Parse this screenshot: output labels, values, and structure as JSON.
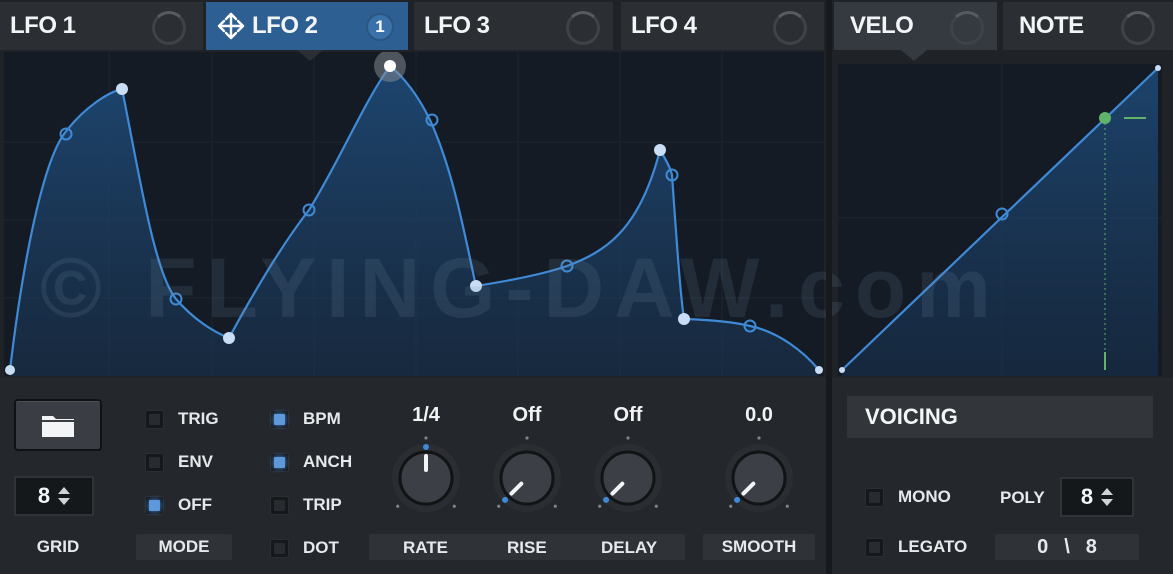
{
  "tabs": {
    "lfo1": "LFO 1",
    "lfo2": "LFO 2",
    "lfo2_badge": "1",
    "lfo3": "LFO 3",
    "lfo4": "LFO 4",
    "velo": "VELO",
    "note": "NOTE"
  },
  "watermark": "© FLYING-DAW.com",
  "grid": {
    "value": "8",
    "label": "GRID"
  },
  "mode": {
    "label": "MODE",
    "options": [
      {
        "label": "TRIG",
        "checked": false
      },
      {
        "label": "ENV",
        "checked": false
      },
      {
        "label": "OFF",
        "checked": true
      }
    ]
  },
  "sync": [
    {
      "label": "BPM",
      "checked": true
    },
    {
      "label": "ANCH",
      "checked": true
    },
    {
      "label": "TRIP",
      "checked": false
    },
    {
      "label": "DOT",
      "checked": false
    }
  ],
  "knobs": {
    "rate": {
      "label": "RATE",
      "value": "1/4",
      "position": 0.5
    },
    "rise": {
      "label": "RISE",
      "value": "Off",
      "position": 0.0
    },
    "delay": {
      "label": "DELAY",
      "value": "Off",
      "position": 0.0
    },
    "smooth": {
      "label": "SMOOTH",
      "value": "0.0",
      "position": 0.0
    }
  },
  "voicing": {
    "title": "VOICING",
    "mono_label": "MONO",
    "legato_label": "LEGATO",
    "poly_label": "POLY",
    "poly_value": "8",
    "voices_used": "0",
    "voices_sep": "\\",
    "voices_total": "8"
  },
  "colors": {
    "accent": "#2d5f92",
    "curve": "#3f8ad6",
    "node": "#c9def4",
    "velo_marker": "#5fb36a"
  }
}
